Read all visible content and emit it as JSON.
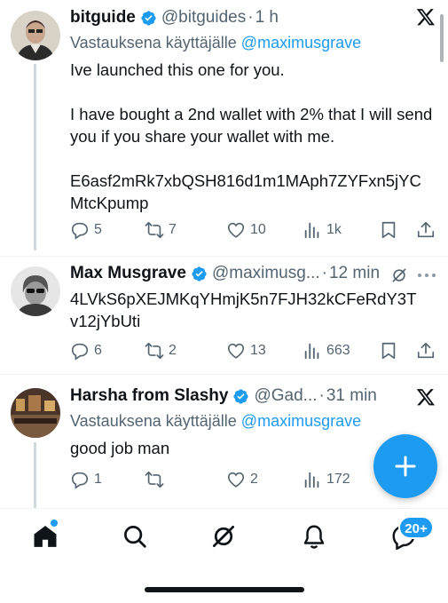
{
  "tweets": [
    {
      "name": "bitguide",
      "handle": "@bitguides",
      "time": "1 h",
      "replying_prefix": "Vastauksena käyttäjälle",
      "replying_to": "@maximusgrave",
      "text_lines": [
        "Ive launched this one for you.",
        "I have bought a 2nd wallet with 2% that I will send you if you share your wallet with me.",
        "E6asf2mRk7xbQSH816d1m1MAph7ZYFxn5jYC MtcKpump"
      ],
      "replies": "5",
      "retweets": "7",
      "likes": "10",
      "views": "1k"
    },
    {
      "name": "Max Musgrave",
      "handle": "@maximusg...",
      "time": "12 min",
      "text_lines": [
        "4LVkS6pXEJMKqYHmjK5n7FJH32kCFeRdY3T v12jYbUti"
      ],
      "replies": "6",
      "retweets": "2",
      "likes": "13",
      "views": "663"
    },
    {
      "name": "Harsha from Slashy",
      "handle": "@Gad...",
      "time": "31 min",
      "replying_prefix": "Vastauksena käyttäjälle",
      "replying_to": "@maximusgrave",
      "text_lines": [
        "good job man"
      ],
      "replies": "1",
      "retweets": "",
      "likes": "2",
      "views": "172"
    }
  ],
  "separator": "·",
  "nav": {
    "messages_badge": "20+"
  },
  "colors": {
    "accent": "#1d9bf0",
    "text": "#0f1419",
    "muted": "#536471"
  }
}
